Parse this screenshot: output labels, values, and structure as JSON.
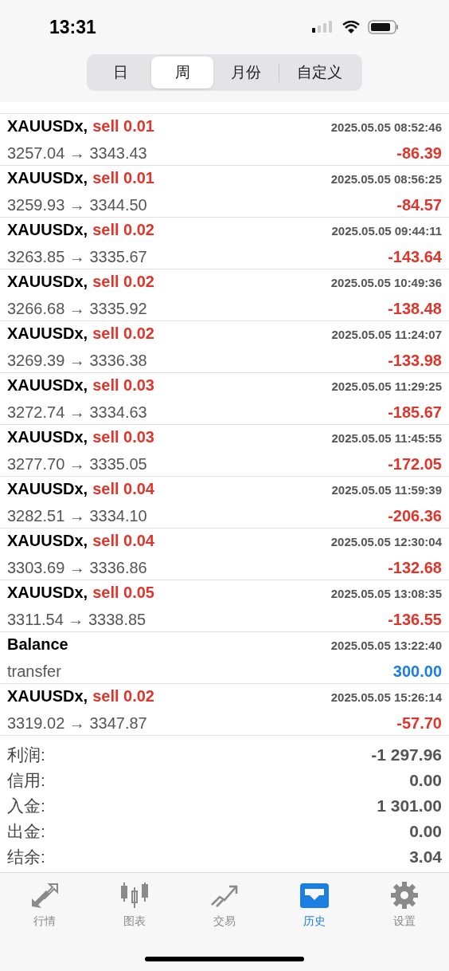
{
  "status_bar": {
    "time": "13:31"
  },
  "period_tabs": [
    {
      "label": "日",
      "selected": false
    },
    {
      "label": "周",
      "selected": true
    },
    {
      "label": "月份",
      "selected": false
    },
    {
      "label": "自定义",
      "selected": false
    }
  ],
  "deals": [
    {
      "kind": "trade",
      "symbol": "XAUUSDx,",
      "side": "sell 0.01",
      "prices": "3257.04 → 3343.43",
      "time": "2025.05.05 08:52:46",
      "profit": "-86.39"
    },
    {
      "kind": "trade",
      "symbol": "XAUUSDx,",
      "side": "sell 0.01",
      "prices": "3259.93 → 3344.50",
      "time": "2025.05.05 08:56:25",
      "profit": "-84.57"
    },
    {
      "kind": "trade",
      "symbol": "XAUUSDx,",
      "side": "sell 0.02",
      "prices": "3263.85 → 3335.67",
      "time": "2025.05.05 09:44:11",
      "profit": "-143.64"
    },
    {
      "kind": "trade",
      "symbol": "XAUUSDx,",
      "side": "sell 0.02",
      "prices": "3266.68 → 3335.92",
      "time": "2025.05.05 10:49:36",
      "profit": "-138.48"
    },
    {
      "kind": "trade",
      "symbol": "XAUUSDx,",
      "side": "sell 0.02",
      "prices": "3269.39 → 3336.38",
      "time": "2025.05.05 11:24:07",
      "profit": "-133.98"
    },
    {
      "kind": "trade",
      "symbol": "XAUUSDx,",
      "side": "sell 0.03",
      "prices": "3272.74 → 3334.63",
      "time": "2025.05.05 11:29:25",
      "profit": "-185.67"
    },
    {
      "kind": "trade",
      "symbol": "XAUUSDx,",
      "side": "sell 0.03",
      "prices": "3277.70 → 3335.05",
      "time": "2025.05.05 11:45:55",
      "profit": "-172.05"
    },
    {
      "kind": "trade",
      "symbol": "XAUUSDx,",
      "side": "sell 0.04",
      "prices": "3282.51 → 3334.10",
      "time": "2025.05.05 11:59:39",
      "profit": "-206.36"
    },
    {
      "kind": "trade",
      "symbol": "XAUUSDx,",
      "side": "sell 0.04",
      "prices": "3303.69 → 3336.86",
      "time": "2025.05.05 12:30:04",
      "profit": "-132.68"
    },
    {
      "kind": "trade",
      "symbol": "XAUUSDx,",
      "side": "sell 0.05",
      "prices": "3311.54 → 3338.85",
      "time": "2025.05.05 13:08:35",
      "profit": "-136.55"
    },
    {
      "kind": "balance",
      "symbol": "Balance",
      "prices": "transfer",
      "time": "2025.05.05 13:22:40",
      "profit": "300.00"
    },
    {
      "kind": "trade",
      "symbol": "XAUUSDx,",
      "side": "sell 0.02",
      "prices": "3319.02 → 3347.87",
      "time": "2025.05.05 15:26:14",
      "profit": "-57.70"
    }
  ],
  "summary": [
    {
      "label": "利润:",
      "value": "-1 297.96"
    },
    {
      "label": "信用:",
      "value": "0.00"
    },
    {
      "label": "入金:",
      "value": "1 301.00"
    },
    {
      "label": "出金:",
      "value": "0.00"
    },
    {
      "label": "结余:",
      "value": "3.04"
    }
  ],
  "tab_bar": [
    {
      "label": "行情",
      "selected": false
    },
    {
      "label": "图表",
      "selected": false
    },
    {
      "label": "交易",
      "selected": false
    },
    {
      "label": "历史",
      "selected": true
    },
    {
      "label": "设置",
      "selected": false
    }
  ]
}
